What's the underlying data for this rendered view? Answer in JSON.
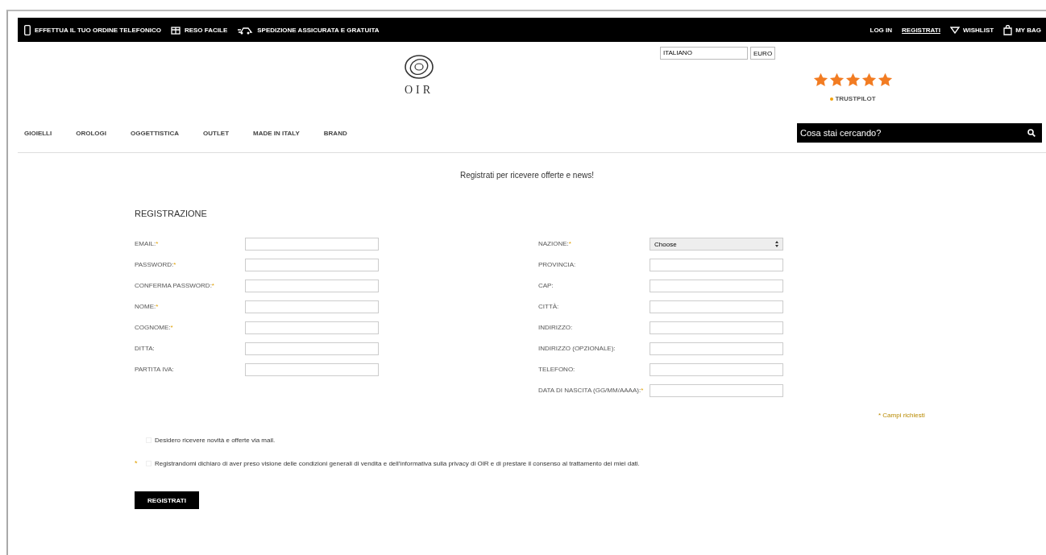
{
  "top_bar": {
    "promos": [
      {
        "kind": "phone",
        "label": "EFFETTUA IL TUO ORDINE TELEFONICO"
      },
      {
        "kind": "gift",
        "label": "RESO FACILE"
      },
      {
        "kind": "truck",
        "label": "SPEDIZIONE ASSICURATA E GRATUITA"
      }
    ],
    "links": [
      {
        "kind": "plain",
        "label": "LOG IN"
      },
      {
        "kind": "underlined",
        "label": "REGISTRATI"
      },
      {
        "kind": "heart",
        "label": "WISHLIST"
      },
      {
        "kind": "bag",
        "label": "MY BAG"
      }
    ]
  },
  "header": {
    "logo_text": "OIR",
    "language": "ITALIANO",
    "currency": "EURO",
    "rating": {
      "stars": 5,
      "source": "TRUSTPILOT"
    }
  },
  "nav": {
    "items": [
      "GIOIELLI",
      "OROLOGI",
      "OGGETTISTICA",
      "OUTLET",
      "MADE IN ITALY",
      "BRAND"
    ],
    "search": {
      "placeholder": "Cosa stai cercando?"
    }
  },
  "subtitle": "Registrati per ricevere offerte e news!",
  "form": {
    "title": "REGISTRAZIONE",
    "required_mark": "*",
    "left_fields": [
      {
        "label": "EMAIL:",
        "required": true,
        "kind": "text"
      },
      {
        "label": "PASSWORD:",
        "required": true,
        "kind": "text"
      },
      {
        "label": "CONFERMA PASSWORD:",
        "required": true,
        "kind": "text"
      },
      {
        "label": "NOME:",
        "required": true,
        "kind": "text"
      },
      {
        "label": "COGNOME:",
        "required": true,
        "kind": "text"
      },
      {
        "label": "DITTA:",
        "required": false,
        "kind": "text"
      },
      {
        "label": "PARTITA IVA:",
        "required": false,
        "kind": "text"
      }
    ],
    "right_fields": [
      {
        "label": "NAZIONE:",
        "required": true,
        "kind": "select",
        "value": "Choose"
      },
      {
        "label": "PROVINCIA:",
        "required": false,
        "kind": "text"
      },
      {
        "label": "CAP:",
        "required": false,
        "kind": "text"
      },
      {
        "label": "CITTÀ:",
        "required": false,
        "kind": "text"
      },
      {
        "label": "INDIRIZZO:",
        "required": false,
        "kind": "text"
      },
      {
        "label": "INDIRIZZO (OPZIONALE):",
        "required": false,
        "kind": "text"
      },
      {
        "label": "TELEFONO:",
        "required": false,
        "kind": "text"
      },
      {
        "label": "DATA DI NASCITA (GG/MM/AAAA):",
        "required": true,
        "kind": "text"
      }
    ],
    "required_note": "* Campi richiesti",
    "checkboxes": [
      {
        "label": "Desidero ricevere novità e offerte via mail.",
        "required": false,
        "checked": false
      },
      {
        "label": "Registrandomi dichiaro di aver preso visione delle condizioni generali di vendita e dell'informativa sulla privacy di OIR e di prestare il consenso al trattamento dei miei dati.",
        "required": true,
        "checked": false
      }
    ],
    "submit": "REGISTRATI"
  }
}
